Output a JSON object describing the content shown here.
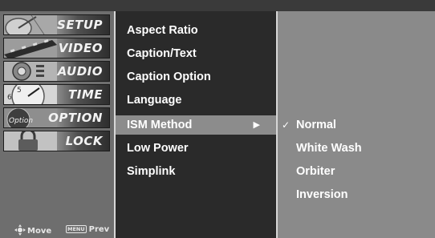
{
  "sidebar": {
    "items": [
      {
        "label": "SETUP",
        "icon": "satellite-dish-icon"
      },
      {
        "label": "VIDEO",
        "icon": "film-reel-icon"
      },
      {
        "label": "AUDIO",
        "icon": "speaker-icon"
      },
      {
        "label": "TIME",
        "icon": "clock-icon"
      },
      {
        "label": "OPTION",
        "icon": "option-badge-icon"
      },
      {
        "label": "LOCK",
        "icon": "lock-icon"
      }
    ],
    "hints": {
      "move_label": "Move",
      "prev_key": "MENU",
      "prev_label": "Prev"
    }
  },
  "menu": {
    "items": [
      {
        "label": "Aspect Ratio"
      },
      {
        "label": "Caption/Text"
      },
      {
        "label": "Caption Option"
      },
      {
        "label": "Language"
      },
      {
        "label": "ISM Method",
        "selected": true,
        "arrow": "▶"
      },
      {
        "label": "Low Power"
      },
      {
        "label": "Simplink"
      }
    ]
  },
  "submenu": {
    "items": [
      {
        "label": "Normal",
        "checked": true,
        "check_mark": "✓"
      },
      {
        "label": "White Wash"
      },
      {
        "label": "Orbiter"
      },
      {
        "label": "Inversion"
      }
    ]
  },
  "colors": {
    "sidebar_bg": "#6e6e6e",
    "menu_bg": "#2a2a2a",
    "selected_bg": "#8c8c8c",
    "submenu_bg": "#8a8a8a",
    "divider": "#d7d7d7"
  }
}
